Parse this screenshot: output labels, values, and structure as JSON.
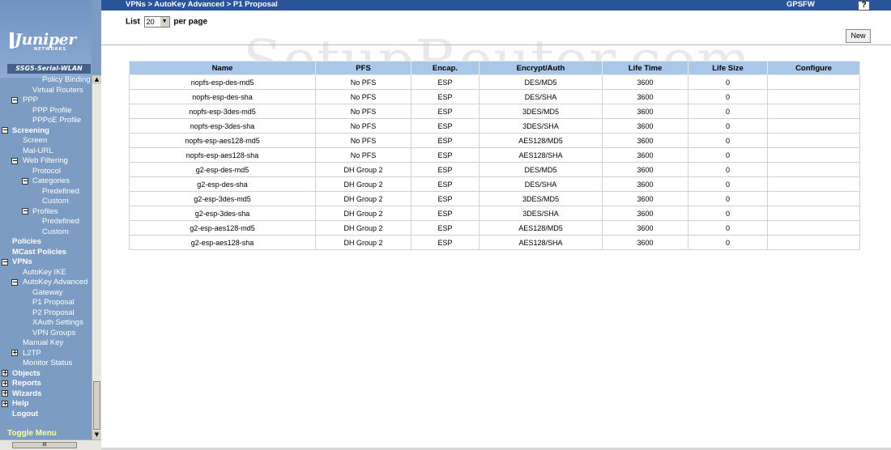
{
  "app": {
    "breadcrumb": "VPNs > AutoKey Advanced > P1 Proposal",
    "hostname": "GPSFW",
    "help_label": "?",
    "logo_text": "Juniper",
    "logo_sub": "NETWORKS",
    "device_name": "SSG5-Serial-WLAN"
  },
  "sidebar": {
    "toggle_label": "Toggle Menu",
    "scroll_grip": "E",
    "hscroll_grip": "III",
    "items": [
      {
        "label": "Policy Binding"
      },
      {
        "label": "Virtual Routers"
      },
      {
        "label": "PPP",
        "box": "−"
      },
      {
        "label": "PPP Profile"
      },
      {
        "label": "PPPoE Profile"
      },
      {
        "label": "Screening",
        "box": "−"
      },
      {
        "label": "Screen"
      },
      {
        "label": "Mal-URL"
      },
      {
        "label": "Web Filtering",
        "box": "−"
      },
      {
        "label": "Protocol"
      },
      {
        "label": "Categories",
        "box": "−"
      },
      {
        "label": "Predefined"
      },
      {
        "label": "Custom"
      },
      {
        "label": "Profiles",
        "box": "−"
      },
      {
        "label": "Predefined"
      },
      {
        "label": "Custom"
      },
      {
        "label": "Policies"
      },
      {
        "label": "MCast Policies"
      },
      {
        "label": "VPNs",
        "box": "−"
      },
      {
        "label": "AutoKey IKE"
      },
      {
        "label": "AutoKey Advanced",
        "box": "−"
      },
      {
        "label": "Gateway"
      },
      {
        "label": "P1 Proposal"
      },
      {
        "label": "P2 Proposal"
      },
      {
        "label": "XAuth Settings"
      },
      {
        "label": "VPN Groups"
      },
      {
        "label": "Manual Key"
      },
      {
        "label": "L2TP",
        "box": "+"
      },
      {
        "label": "Monitor Status"
      },
      {
        "label": "Objects",
        "box": "+"
      },
      {
        "label": "Reports",
        "box": "+"
      },
      {
        "label": "Wizards",
        "box": "+"
      },
      {
        "label": "Help",
        "box": "+"
      },
      {
        "label": "Logout"
      }
    ]
  },
  "main": {
    "list_prefix": "List",
    "list_value": "20",
    "list_suffix": "per page",
    "new_label": "New",
    "watermark": "SetupRouter.com"
  },
  "table": {
    "columns": [
      "Name",
      "PFS",
      "Encap.",
      "Encrypt/Auth",
      "Life Time",
      "Life Size",
      "Configure"
    ],
    "rows": [
      [
        "nopfs-esp-des-md5",
        "No PFS",
        "ESP",
        "DES/MD5",
        "3600",
        "0",
        ""
      ],
      [
        "nopfs-esp-des-sha",
        "No PFS",
        "ESP",
        "DES/SHA",
        "3600",
        "0",
        ""
      ],
      [
        "nopfs-esp-3des-md5",
        "No PFS",
        "ESP",
        "3DES/MD5",
        "3600",
        "0",
        ""
      ],
      [
        "nopfs-esp-3des-sha",
        "No PFS",
        "ESP",
        "3DES/SHA",
        "3600",
        "0",
        ""
      ],
      [
        "nopfs-esp-aes128-md5",
        "No PFS",
        "ESP",
        "AES128/MD5",
        "3600",
        "0",
        ""
      ],
      [
        "nopfs-esp-aes128-sha",
        "No PFS",
        "ESP",
        "AES128/SHA",
        "3600",
        "0",
        ""
      ],
      [
        "g2-esp-des-md5",
        "DH Group 2",
        "ESP",
        "DES/MD5",
        "3600",
        "0",
        ""
      ],
      [
        "g2-esp-des-sha",
        "DH Group 2",
        "ESP",
        "DES/SHA",
        "3600",
        "0",
        ""
      ],
      [
        "g2-esp-3des-md5",
        "DH Group 2",
        "ESP",
        "3DES/MD5",
        "3600",
        "0",
        ""
      ],
      [
        "g2-esp-3des-sha",
        "DH Group 2",
        "ESP",
        "3DES/SHA",
        "3600",
        "0",
        ""
      ],
      [
        "g2-esp-aes128-md5",
        "DH Group 2",
        "ESP",
        "AES128/MD5",
        "3600",
        "0",
        ""
      ],
      [
        "g2-esp-aes128-sha",
        "DH Group 2",
        "ESP",
        "AES128/SHA",
        "3600",
        "0",
        ""
      ]
    ]
  },
  "colors": {
    "topbar": "#2a5599",
    "sidebar": "#7d9cc4",
    "table_header": "#a9c7e6",
    "toggle_text": "#ffff99"
  }
}
